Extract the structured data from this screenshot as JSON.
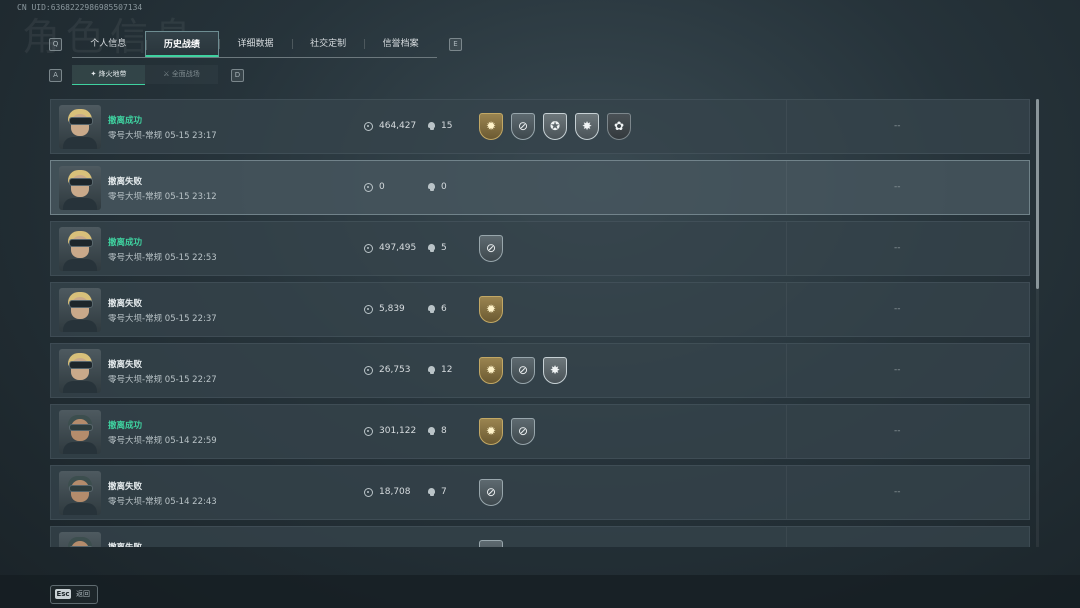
{
  "header": {
    "uid": "CN UID:6368222986985507134",
    "watermark_title": "角色信息",
    "key_left": "Q",
    "key_right": "E",
    "sub_key_left": "A",
    "sub_key_right": "D"
  },
  "tabs": [
    {
      "label": "个人信息",
      "active": false
    },
    {
      "label": "历史战绩",
      "active": true
    },
    {
      "label": "详细数据",
      "active": false
    },
    {
      "label": "社交定制",
      "active": false
    },
    {
      "label": "信誉档案",
      "active": false
    }
  ],
  "subtabs": [
    {
      "label": "烽火地带",
      "active": true
    },
    {
      "label": "全面战场",
      "active": false
    }
  ],
  "matches": [
    {
      "status": "撤离成功",
      "success": true,
      "map": "零号大坝-常规",
      "time": "05-15 23:17",
      "value": "464,427",
      "kills": "15",
      "badges": [
        "gold-sun",
        "silver-target",
        "white-star",
        "white-burst",
        "dark-trophy"
      ],
      "extra": "--",
      "avatar": "female"
    },
    {
      "status": "撤离失败",
      "success": false,
      "map": "零号大坝-常规",
      "time": "05-15 23:12",
      "value": "0",
      "kills": "0",
      "badges": [],
      "extra": "--",
      "avatar": "female",
      "selected": true
    },
    {
      "status": "撤离成功",
      "success": true,
      "map": "零号大坝-常规",
      "time": "05-15 22:53",
      "value": "497,495",
      "kills": "5",
      "badges": [
        "silver-target"
      ],
      "extra": "--",
      "avatar": "female"
    },
    {
      "status": "撤离失败",
      "success": false,
      "map": "零号大坝-常规",
      "time": "05-15 22:37",
      "value": "5,839",
      "kills": "6",
      "badges": [
        "gold-sun"
      ],
      "extra": "--",
      "avatar": "female"
    },
    {
      "status": "撤离失败",
      "success": false,
      "map": "零号大坝-常规",
      "time": "05-15 22:27",
      "value": "26,753",
      "kills": "12",
      "badges": [
        "gold-sun",
        "silver-target",
        "white-burst"
      ],
      "extra": "--",
      "avatar": "female"
    },
    {
      "status": "撤离成功",
      "success": true,
      "map": "零号大坝-常规",
      "time": "05-14 22:59",
      "value": "301,122",
      "kills": "8",
      "badges": [
        "gold-sun",
        "silver-target"
      ],
      "extra": "--",
      "avatar": "male"
    },
    {
      "status": "撤离失败",
      "success": false,
      "map": "零号大坝-常规",
      "time": "05-14 22:43",
      "value": "18,708",
      "kills": "7",
      "badges": [
        "silver-target"
      ],
      "extra": "--",
      "avatar": "male"
    },
    {
      "status": "撤离失败",
      "success": false,
      "map": "",
      "time": "",
      "value": "",
      "kills": "",
      "badges": [
        "silver-target"
      ],
      "extra": "",
      "avatar": "male"
    }
  ],
  "footer": {
    "key": "Esc",
    "label": "返回"
  },
  "colors": {
    "success": "#3fd2a0",
    "accent": "#3fd2a0"
  }
}
